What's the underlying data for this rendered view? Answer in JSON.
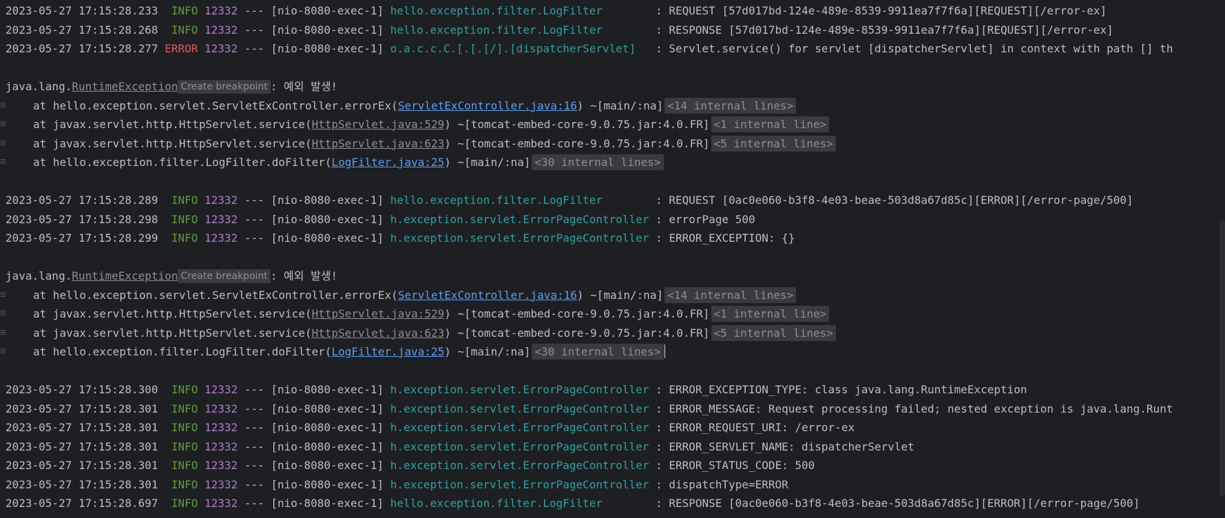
{
  "console": {
    "hint_label": "Create breakpoint",
    "blocks": [
      {
        "kind": "log",
        "ts": "2023-05-27 17:15:28.233",
        "level": "INFO",
        "pid": "12332",
        "sep": "---",
        "thread": "[nio-8080-exec-1]",
        "logger": "hello.exception.filter.LogFilter",
        "logger_pad": "        ",
        "msg": ": REQUEST [57d017bd-124e-489e-8539-9911ea7f7f6a][REQUEST][/error-ex]"
      },
      {
        "kind": "log",
        "ts": "2023-05-27 17:15:28.268",
        "level": "INFO",
        "pid": "12332",
        "sep": "---",
        "thread": "[nio-8080-exec-1]",
        "logger": "hello.exception.filter.LogFilter",
        "logger_pad": "        ",
        "msg": ": RESPONSE [57d017bd-124e-489e-8539-9911ea7f7f6a][REQUEST][/error-ex]"
      },
      {
        "kind": "log",
        "ts": "2023-05-27 17:15:28.277",
        "level": "ERROR",
        "pid": "12332",
        "sep": "---",
        "thread": "[nio-8080-exec-1]",
        "logger": "o.a.c.c.C.[.[.[/].[dispatcherServlet]",
        "logger_pad": "   ",
        "msg": ": Servlet.service() for servlet [dispatcherServlet] in context with path [] th"
      },
      {
        "kind": "blank"
      },
      {
        "kind": "exception",
        "prefix": "java.lang.",
        "name": "RuntimeException",
        "message": ": 예외 발생!"
      },
      {
        "kind": "frame",
        "pre": "at hello.exception.servlet.ServletExController.errorEx(",
        "link": "ServletExController.java:16",
        "link_style": "blue",
        "post": ") ~[main/:na]",
        "internal": "<14 internal lines>"
      },
      {
        "kind": "frame",
        "pre": "at javax.servlet.http.HttpServlet.service(",
        "link": "HttpServlet.java:529",
        "link_style": "gray",
        "post": ") ~[tomcat-embed-core-9.0.75.jar:4.0.FR]",
        "internal": "<1 internal line>"
      },
      {
        "kind": "frame",
        "pre": "at javax.servlet.http.HttpServlet.service(",
        "link": "HttpServlet.java:623",
        "link_style": "gray",
        "post": ") ~[tomcat-embed-core-9.0.75.jar:4.0.FR]",
        "internal": "<5 internal lines>"
      },
      {
        "kind": "frame",
        "pre": "at hello.exception.filter.LogFilter.doFilter(",
        "link": "LogFilter.java:25",
        "link_style": "blue",
        "post": ") ~[main/:na]",
        "internal": "<30 internal lines>"
      },
      {
        "kind": "blank"
      },
      {
        "kind": "log",
        "ts": "2023-05-27 17:15:28.289",
        "level": "INFO",
        "pid": "12332",
        "sep": "---",
        "thread": "[nio-8080-exec-1]",
        "logger": "hello.exception.filter.LogFilter",
        "logger_pad": "        ",
        "msg": ": REQUEST [0ac0e060-b3f8-4e03-beae-503d8a67d85c][ERROR][/error-page/500]"
      },
      {
        "kind": "log",
        "ts": "2023-05-27 17:15:28.298",
        "level": "INFO",
        "pid": "12332",
        "sep": "---",
        "thread": "[nio-8080-exec-1]",
        "logger": "h.exception.servlet.ErrorPageController",
        "logger_pad": " ",
        "msg": ": errorPage 500"
      },
      {
        "kind": "log",
        "ts": "2023-05-27 17:15:28.299",
        "level": "INFO",
        "pid": "12332",
        "sep": "---",
        "thread": "[nio-8080-exec-1]",
        "logger": "h.exception.servlet.ErrorPageController",
        "logger_pad": " ",
        "msg": ": ERROR_EXCEPTION: {}"
      },
      {
        "kind": "blank"
      },
      {
        "kind": "exception",
        "prefix": "java.lang.",
        "name": "RuntimeException",
        "message": ": 예외 발생!"
      },
      {
        "kind": "frame",
        "pre": "at hello.exception.servlet.ServletExController.errorEx(",
        "link": "ServletExController.java:16",
        "link_style": "blue",
        "post": ") ~[main/:na]",
        "internal": "<14 internal lines>"
      },
      {
        "kind": "frame",
        "pre": "at javax.servlet.http.HttpServlet.service(",
        "link": "HttpServlet.java:529",
        "link_style": "gray",
        "post": ") ~[tomcat-embed-core-9.0.75.jar:4.0.FR]",
        "internal": "<1 internal line>"
      },
      {
        "kind": "frame",
        "pre": "at javax.servlet.http.HttpServlet.service(",
        "link": "HttpServlet.java:623",
        "link_style": "gray",
        "post": ") ~[tomcat-embed-core-9.0.75.jar:4.0.FR]",
        "internal": "<5 internal lines>"
      },
      {
        "kind": "frame",
        "pre": "at hello.exception.filter.LogFilter.doFilter(",
        "link": "LogFilter.java:25",
        "link_style": "blue",
        "post": ") ~[main/:na]",
        "internal": "<30 internal lines>",
        "caret": true
      },
      {
        "kind": "blank"
      },
      {
        "kind": "log",
        "ts": "2023-05-27 17:15:28.300",
        "level": "INFO",
        "pid": "12332",
        "sep": "---",
        "thread": "[nio-8080-exec-1]",
        "logger": "h.exception.servlet.ErrorPageController",
        "logger_pad": " ",
        "msg": ": ERROR_EXCEPTION_TYPE: class java.lang.RuntimeException"
      },
      {
        "kind": "log",
        "ts": "2023-05-27 17:15:28.301",
        "level": "INFO",
        "pid": "12332",
        "sep": "---",
        "thread": "[nio-8080-exec-1]",
        "logger": "h.exception.servlet.ErrorPageController",
        "logger_pad": " ",
        "msg": ": ERROR_MESSAGE: Request processing failed; nested exception is java.lang.Runt"
      },
      {
        "kind": "log",
        "ts": "2023-05-27 17:15:28.301",
        "level": "INFO",
        "pid": "12332",
        "sep": "---",
        "thread": "[nio-8080-exec-1]",
        "logger": "h.exception.servlet.ErrorPageController",
        "logger_pad": " ",
        "msg": ": ERROR_REQUEST_URI: /error-ex"
      },
      {
        "kind": "log",
        "ts": "2023-05-27 17:15:28.301",
        "level": "INFO",
        "pid": "12332",
        "sep": "---",
        "thread": "[nio-8080-exec-1]",
        "logger": "h.exception.servlet.ErrorPageController",
        "logger_pad": " ",
        "msg": ": ERROR_SERVLET_NAME: dispatcherServlet"
      },
      {
        "kind": "log",
        "ts": "2023-05-27 17:15:28.301",
        "level": "INFO",
        "pid": "12332",
        "sep": "---",
        "thread": "[nio-8080-exec-1]",
        "logger": "h.exception.servlet.ErrorPageController",
        "logger_pad": " ",
        "msg": ": ERROR_STATUS_CODE: 500"
      },
      {
        "kind": "log",
        "ts": "2023-05-27 17:15:28.301",
        "level": "INFO",
        "pid": "12332",
        "sep": "---",
        "thread": "[nio-8080-exec-1]",
        "logger": "h.exception.servlet.ErrorPageController",
        "logger_pad": " ",
        "msg": ": dispatchType=ERROR"
      },
      {
        "kind": "log",
        "ts": "2023-05-27 17:15:28.697",
        "level": "INFO",
        "pid": "12332",
        "sep": "---",
        "thread": "[nio-8080-exec-1]",
        "logger": "hello.exception.filter.LogFilter",
        "logger_pad": "        ",
        "msg": ": RESPONSE [0ac0e060-b3f8-4e03-beae-503d8a67d85c][ERROR][/error-page/500]"
      }
    ]
  },
  "colors": {
    "background": "#1e1f22",
    "text": "#bcbec4",
    "info": "#5f9c3c",
    "error": "#e05a5a",
    "pid": "#b07ccf",
    "logger": "#2aa3a3",
    "link": "#5a9ef5"
  },
  "icons": {
    "fold": "fold-gutter-icon"
  }
}
